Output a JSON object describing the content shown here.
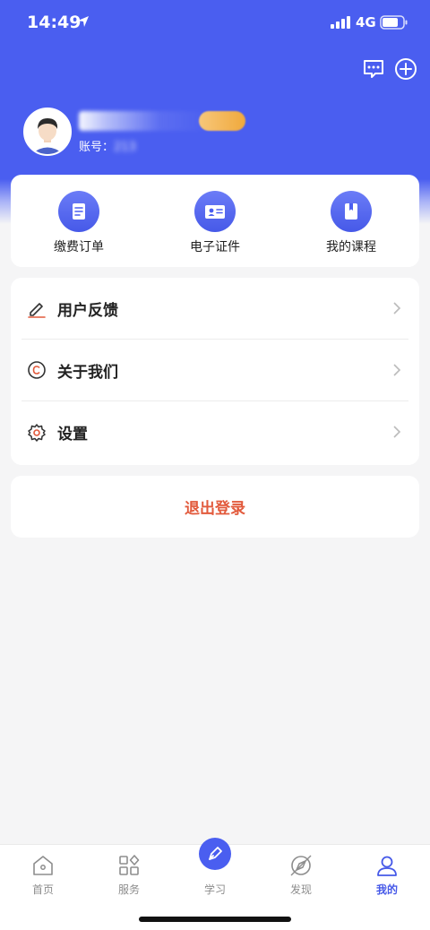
{
  "status": {
    "time": "14:49",
    "network": "4G"
  },
  "profile": {
    "account_label": "账号：",
    "account_value": "213"
  },
  "quick_actions": [
    {
      "label": "缴费订单",
      "icon": "order-document-icon"
    },
    {
      "label": "电子证件",
      "icon": "id-card-icon"
    },
    {
      "label": "我的课程",
      "icon": "course-book-icon"
    }
  ],
  "menu": [
    {
      "label": "用户反馈",
      "icon": "pencil-icon"
    },
    {
      "label": "关于我们",
      "icon": "copyright-icon"
    },
    {
      "label": "设置",
      "icon": "gear-icon"
    }
  ],
  "logout_label": "退出登录",
  "tabs": [
    {
      "label": "首页",
      "icon": "home-icon"
    },
    {
      "label": "服务",
      "icon": "grid-icon"
    },
    {
      "label": "学习",
      "icon": "pen-icon"
    },
    {
      "label": "发现",
      "icon": "compass-icon"
    },
    {
      "label": "我的",
      "icon": "user-icon"
    }
  ],
  "colors": {
    "primary": "#4a5ef0",
    "logout": "#e25a3c"
  }
}
